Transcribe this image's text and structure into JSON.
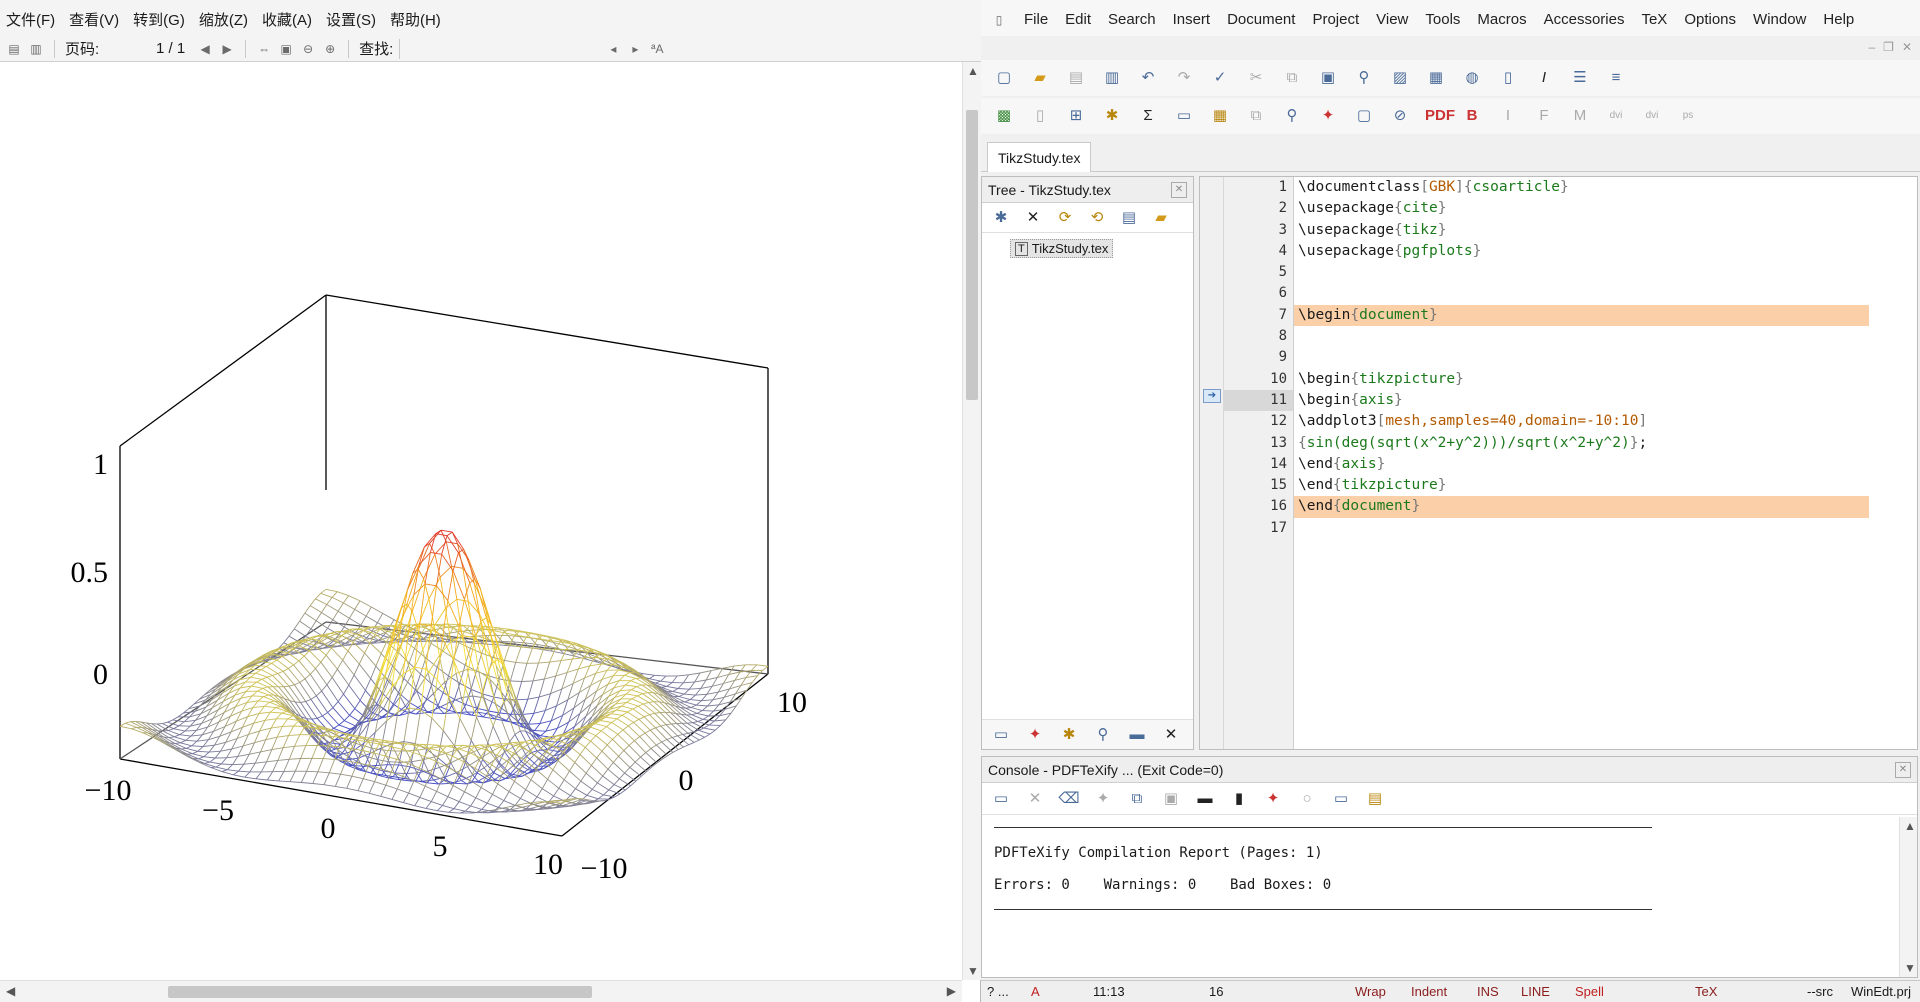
{
  "viewer": {
    "menu": [
      "文件(F)",
      "查看(V)",
      "转到(G)",
      "缩放(Z)",
      "收藏(A)",
      "设置(S)",
      "帮助(H)"
    ],
    "page_label": "页码:",
    "page_value": "1 / 1",
    "find_label": "查找:",
    "plot": {
      "z_ticks": [
        "1",
        "0.5",
        "0"
      ],
      "x_ticks": [
        "−10",
        "−5",
        "0",
        "5",
        "10"
      ],
      "y_ticks": [
        "−10",
        "0",
        "10"
      ]
    }
  },
  "editor": {
    "menu": [
      "File",
      "Edit",
      "Search",
      "Insert",
      "Document",
      "Project",
      "View",
      "Tools",
      "Macros",
      "Accessories",
      "TeX",
      "Options",
      "Window",
      "Help"
    ],
    "tab": "TikzStudy.tex",
    "tree_title": "Tree - TikzStudy.tex",
    "tree_item": "TikzStudy.tex",
    "line_numbers": [
      "1",
      "2",
      "3",
      "4",
      "5",
      "6",
      "7",
      "8",
      "9",
      "10",
      "11",
      "12",
      "13",
      "14",
      "15",
      "16",
      "17"
    ],
    "code": [
      "\\documentclass[GBK]{csoarticle}",
      "\\usepackage{cite}",
      "\\usepackage{tikz}",
      "\\usepackage{pgfplots}",
      "",
      "",
      "\\begin{document}",
      "",
      "",
      "\\begin{tikzpicture}",
      "\\begin{axis}",
      "\\addplot3[mesh,samples=40,domain=-10:10]",
      "{sin(deg(sqrt(x^2+y^2)))/sqrt(x^2+y^2)};",
      "\\end{axis}",
      "\\end{tikzpicture}",
      "\\end{document}",
      ""
    ],
    "console_title": "Console - PDFTeXify ... (Exit Code=0)",
    "console_report": "PDFTeXify Compilation Report (Pages: 1)",
    "console_errors": "Errors: 0    Warnings: 0    Bad Boxes: 0",
    "status": {
      "help": "? ...",
      "mode": "A",
      "position": "11:13",
      "col": "16",
      "wrap": "Wrap",
      "indent": "Indent",
      "ins": "INS",
      "line": "LINE",
      "spell": "Spell",
      "tex": "TeX",
      "src": "--src",
      "project": "WinEdt.prj"
    }
  },
  "colors": {
    "peak": "#e0302a",
    "mid": "#f3e13a",
    "low": "#3f48c8",
    "highlight": "#fbd0a8"
  }
}
